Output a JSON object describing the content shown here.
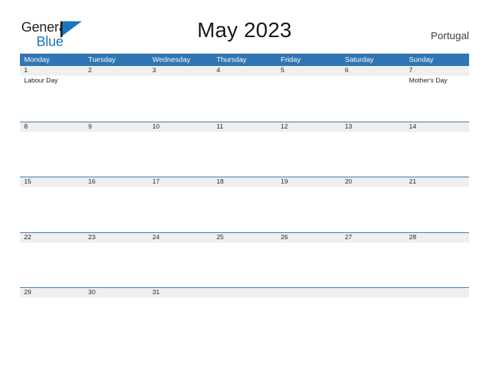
{
  "brand": {
    "name_part1": "General",
    "name_part2": "Blue",
    "flag_icon": "flag-triangle-icon",
    "accent_color": "#1878be"
  },
  "header": {
    "title": "May 2023",
    "locale": "Portugal"
  },
  "colors": {
    "header_blue": "#3075b4",
    "row_divider_blue": "#2e6da4",
    "date_band_gray": "#efefef",
    "text_dark": "#1a1a1a",
    "text_white": "#ffffff"
  },
  "calendar": {
    "month": "May",
    "year": "2023",
    "weekday_headers": [
      "Monday",
      "Tuesday",
      "Wednesday",
      "Thursday",
      "Friday",
      "Saturday",
      "Sunday"
    ],
    "weeks": [
      [
        {
          "date": "1",
          "events": [
            "Labour Day"
          ]
        },
        {
          "date": "2",
          "events": []
        },
        {
          "date": "3",
          "events": []
        },
        {
          "date": "4",
          "events": []
        },
        {
          "date": "5",
          "events": []
        },
        {
          "date": "6",
          "events": []
        },
        {
          "date": "7",
          "events": [
            "Mother's Day"
          ]
        }
      ],
      [
        {
          "date": "8",
          "events": []
        },
        {
          "date": "9",
          "events": []
        },
        {
          "date": "10",
          "events": []
        },
        {
          "date": "11",
          "events": []
        },
        {
          "date": "12",
          "events": []
        },
        {
          "date": "13",
          "events": []
        },
        {
          "date": "14",
          "events": []
        }
      ],
      [
        {
          "date": "15",
          "events": []
        },
        {
          "date": "16",
          "events": []
        },
        {
          "date": "17",
          "events": []
        },
        {
          "date": "18",
          "events": []
        },
        {
          "date": "19",
          "events": []
        },
        {
          "date": "20",
          "events": []
        },
        {
          "date": "21",
          "events": []
        }
      ],
      [
        {
          "date": "22",
          "events": []
        },
        {
          "date": "23",
          "events": []
        },
        {
          "date": "24",
          "events": []
        },
        {
          "date": "25",
          "events": []
        },
        {
          "date": "26",
          "events": []
        },
        {
          "date": "27",
          "events": []
        },
        {
          "date": "28",
          "events": []
        }
      ],
      [
        {
          "date": "29",
          "events": []
        },
        {
          "date": "30",
          "events": []
        },
        {
          "date": "31",
          "events": []
        },
        {
          "date": "",
          "events": []
        },
        {
          "date": "",
          "events": []
        },
        {
          "date": "",
          "events": []
        },
        {
          "date": "",
          "events": []
        }
      ]
    ]
  }
}
